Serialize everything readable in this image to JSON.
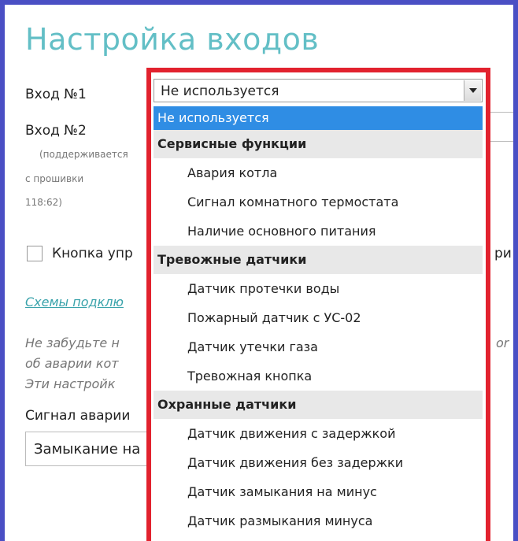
{
  "page": {
    "title": "Настройка входов",
    "input1_label": "Вход №1",
    "input2_label": "Вход №2",
    "note_line1": "(поддерживается",
    "note_line2": "с прошивки",
    "note_line3": "118:62)",
    "button_label": "Кнопка упр",
    "right_fragment": "ри",
    "link_text": "Схемы подклю",
    "hint_line1": "Не забудьте н",
    "hint_line2": "об аварии кот",
    "hint_line3": "Эти настройк",
    "hint_right": "or",
    "signal_label": "Сигнал аварии",
    "signal_value": "Замыкание на"
  },
  "dropdown": {
    "selected_value": "Не используется",
    "options": [
      {
        "kind": "option",
        "label": "Не используется",
        "selected": true
      },
      {
        "kind": "group",
        "label": "Сервисные функции"
      },
      {
        "kind": "option",
        "label": "Авария котла"
      },
      {
        "kind": "option",
        "label": "Сигнал комнатного термостата"
      },
      {
        "kind": "option",
        "label": "Наличие основного питания"
      },
      {
        "kind": "group",
        "label": "Тревожные датчики"
      },
      {
        "kind": "option",
        "label": "Датчик протечки воды"
      },
      {
        "kind": "option",
        "label": "Пожарный датчик с УС-02"
      },
      {
        "kind": "option",
        "label": "Датчик утечки газа"
      },
      {
        "kind": "option",
        "label": "Тревожная кнопка"
      },
      {
        "kind": "group",
        "label": "Охранные датчики"
      },
      {
        "kind": "option",
        "label": "Датчик движения с задержкой"
      },
      {
        "kind": "option",
        "label": "Датчик движения без задержки"
      },
      {
        "kind": "option",
        "label": "Датчик замыкания на минус"
      },
      {
        "kind": "option",
        "label": "Датчик размыкания минуса"
      }
    ]
  },
  "colors": {
    "frame": "#4a4fc4",
    "highlight": "#e2222e",
    "title": "#63bfc6",
    "selected": "#2f8de4"
  }
}
